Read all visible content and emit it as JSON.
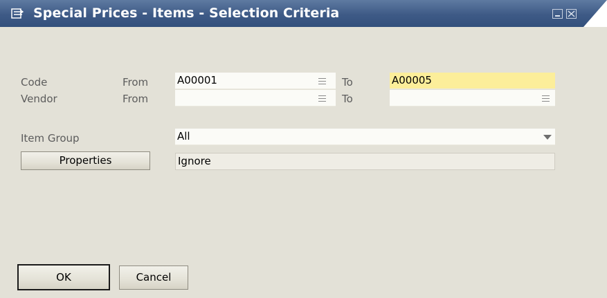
{
  "window": {
    "title": "Special Prices - Items - Selection Criteria",
    "icon": "form-icon",
    "controls": {
      "minimize_icon": "minimize-icon",
      "close_icon": "close-icon"
    }
  },
  "criteria": {
    "code": {
      "label": "Code",
      "from_label": "From",
      "from_value": "A00001",
      "to_label": "To",
      "to_value": "A00005"
    },
    "vendor": {
      "label": "Vendor",
      "from_label": "From",
      "from_value": "",
      "to_label": "To",
      "to_value": ""
    },
    "item_group": {
      "label": "Item Group",
      "value": "All"
    },
    "properties": {
      "button_label": "Properties",
      "value": "Ignore"
    }
  },
  "actions": {
    "ok_label": "OK",
    "cancel_label": "Cancel"
  },
  "colors": {
    "title_bar": "#3e5a86",
    "highlight_field": "#fcee9a",
    "background": "#e3e1d7"
  }
}
